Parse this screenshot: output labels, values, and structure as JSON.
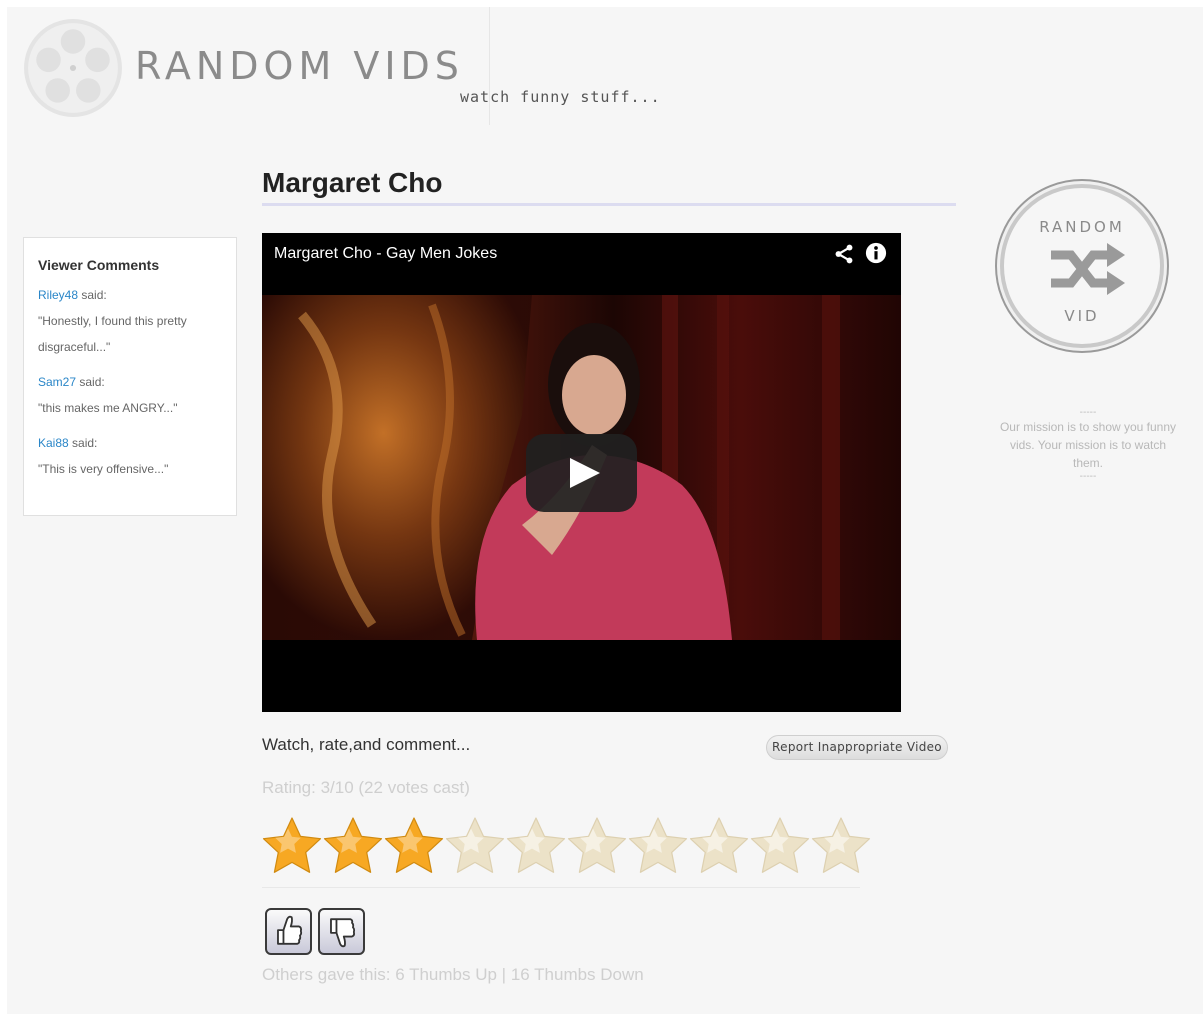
{
  "header": {
    "logo_title": "RANDOM VIDS",
    "tagline": "watch funny stuff..."
  },
  "video": {
    "page_title": "Margaret Cho",
    "player_title": "Margaret Cho - Gay Men Jokes"
  },
  "comments": {
    "heading": "Viewer Comments",
    "said_word": "said:",
    "items": [
      {
        "user": "Riley48",
        "text": "\"Honestly, I found this pretty disgraceful...\""
      },
      {
        "user": "Sam27",
        "text": "\"this makes me ANGRY...\""
      },
      {
        "user": "Kai88",
        "text": "\"This is very offensive...\""
      }
    ]
  },
  "sidebar": {
    "badge_top": "RANDOM",
    "badge_bottom": "VID",
    "dash": "-----",
    "mission": "Our mission is to show you funny vids. Your mission is to watch them."
  },
  "actions": {
    "watch_line": "Watch, rate,and comment...",
    "report_label": "Report Inappropriate Video",
    "rating_text": "Rating: 3/10 (22 votes cast)",
    "rating_value": 3,
    "rating_max": 10,
    "thumbs_text": "Others gave this: 6 Thumbs Up | 16 Thumbs Down"
  },
  "colors": {
    "star_filled": "#f7a823",
    "star_empty": "#ece2c8",
    "link": "#2a86c8"
  },
  "icons": [
    "share-icon",
    "info-icon",
    "play-icon",
    "shuffle-icon",
    "thumbs-up-icon",
    "thumbs-down-icon",
    "film-reel-icon"
  ]
}
